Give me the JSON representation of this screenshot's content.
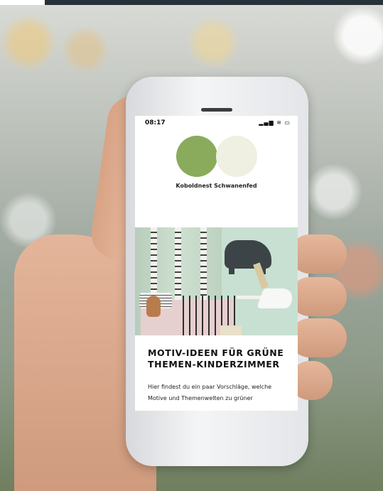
{
  "status_bar": {
    "time": "08:17",
    "icons": [
      "signal-icon",
      "wifi-icon",
      "battery-icon"
    ],
    "icon_glyphs": "▂▄▆ ≋ ▭"
  },
  "header": {
    "brand": "Koboldnest Schwanenfed",
    "logo_colors": [
      "#8aab5c",
      "#efefe2"
    ]
  },
  "article": {
    "title": "MOTIV-IDEEN FÜR GRÜNE THEMEN-KINDERZIMMER",
    "intro": "Hier findest du ein paar Vorschläge, welche Motive und Themenwelten zu grüner"
  },
  "colors": {
    "top_bar": "#263238",
    "accent_green": "#8aab5c"
  }
}
